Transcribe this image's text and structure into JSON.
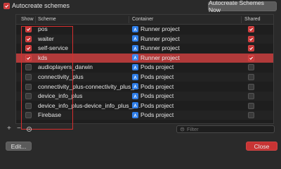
{
  "top": {
    "autocreate_label": "Autocreate schemes",
    "autocreate_checked": true,
    "autocreate_now_button": "Autocreate Schemes Now"
  },
  "table": {
    "headers": {
      "show": "Show",
      "scheme": "Scheme",
      "container": "Container",
      "shared": "Shared"
    },
    "rows": [
      {
        "show": true,
        "scheme": "pos",
        "container": "Runner project",
        "shared": true,
        "selected": false
      },
      {
        "show": true,
        "scheme": "waiter",
        "container": "Runner project",
        "shared": true,
        "selected": false
      },
      {
        "show": true,
        "scheme": "self-service",
        "container": "Runner project",
        "shared": true,
        "selected": false
      },
      {
        "show": true,
        "scheme": "kds",
        "container": "Runner project",
        "shared": true,
        "selected": true
      },
      {
        "show": false,
        "scheme": "audioplayers_darwin",
        "container": "Pods project",
        "shared": false,
        "selected": false
      },
      {
        "show": false,
        "scheme": "connectivity_plus",
        "container": "Pods project",
        "shared": false,
        "selected": false
      },
      {
        "show": false,
        "scheme": "connectivity_plus-connectivity_plus_...",
        "container": "Pods project",
        "shared": false,
        "selected": false
      },
      {
        "show": false,
        "scheme": "device_info_plus",
        "container": "Pods project",
        "shared": false,
        "selected": false
      },
      {
        "show": false,
        "scheme": "device_info_plus-device_info_plus_p...",
        "container": "Pods project",
        "shared": false,
        "selected": false
      },
      {
        "show": false,
        "scheme": "Firebase",
        "container": "Pods project",
        "shared": false,
        "selected": false
      }
    ]
  },
  "toolbar": {
    "add": "+",
    "remove": "−",
    "filter_placeholder": "Filter"
  },
  "buttons": {
    "edit": "Edit...",
    "close": "Close"
  },
  "colors": {
    "accent": "#c83434",
    "selection": "#b13a3a",
    "app_icon": "#2f7ee8"
  }
}
